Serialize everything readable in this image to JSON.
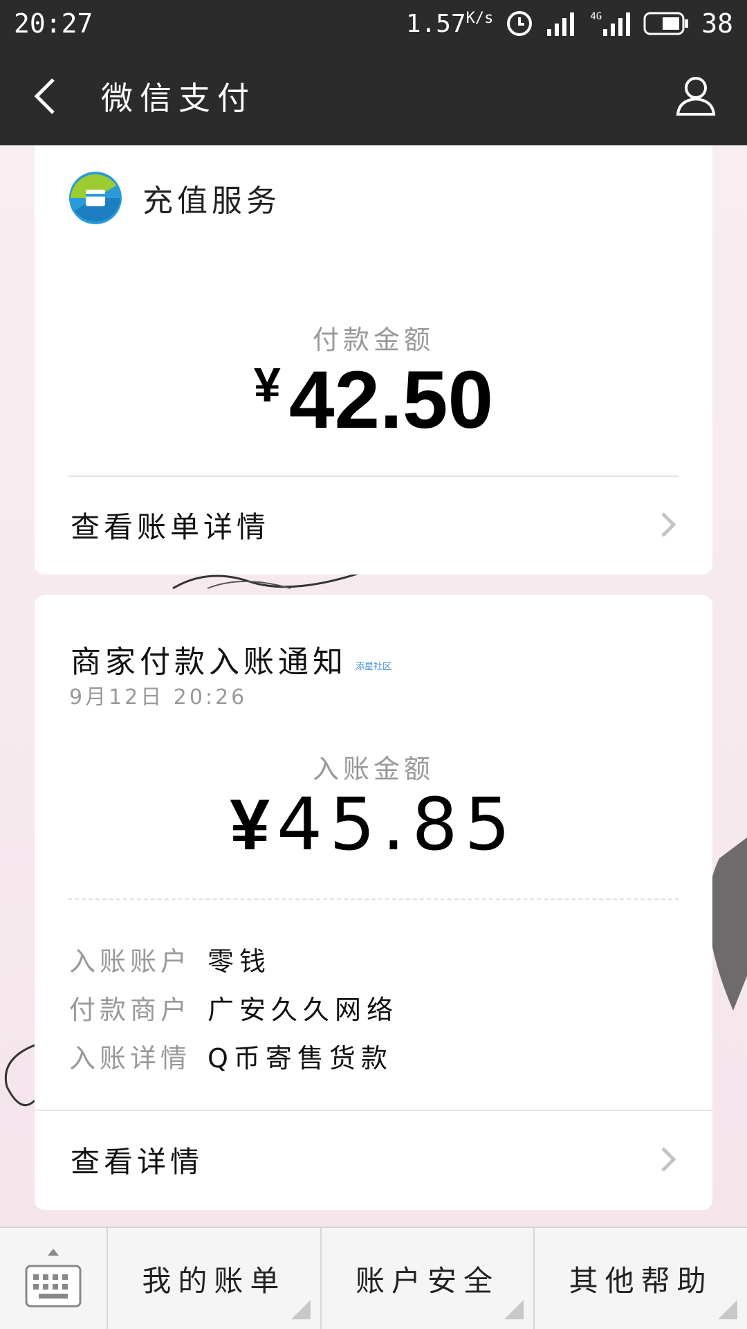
{
  "status_bar": {
    "time": "20:27",
    "speed": "1.57",
    "speed_unit": "K/s",
    "network": "4G",
    "battery": "38"
  },
  "app_bar": {
    "title": "微信支付"
  },
  "card1": {
    "service_name": "充值服务",
    "amount_label": "付款金额",
    "currency": "¥",
    "amount": "42.50",
    "link_label": "查看账单详情"
  },
  "card2": {
    "title": "商家付款入账通知",
    "watermark": "添星社区",
    "time": "9月12日  20:26",
    "amount_label": "入账金额",
    "currency": "¥",
    "amount": "45.85",
    "info": [
      {
        "key": "入账账户",
        "value": "零钱"
      },
      {
        "key": "付款商户",
        "value": "广安久久网络"
      },
      {
        "key": "入账详情",
        "value": "Q币寄售货款"
      }
    ],
    "link_label": "查看详情"
  },
  "bottom_menu": {
    "items": [
      "我的账单",
      "账户安全",
      "其他帮助"
    ]
  }
}
